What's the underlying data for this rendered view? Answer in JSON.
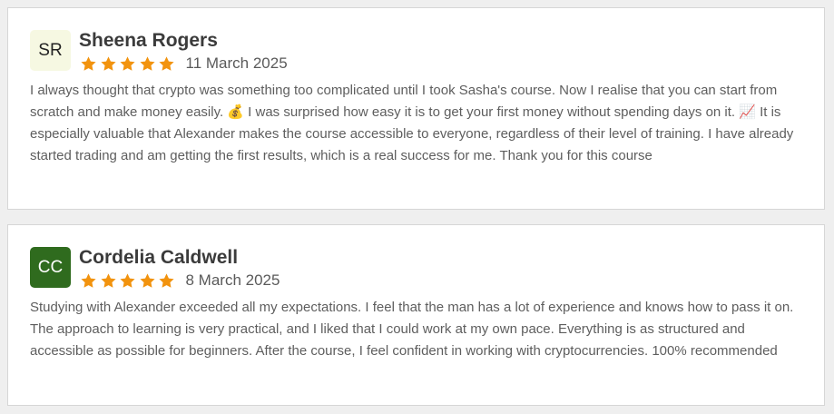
{
  "reviews": [
    {
      "initials": "SR",
      "avatar_bg": "#f6f8e2",
      "avatar_fg": "#222222",
      "name": "Sheena Rogers",
      "rating": 5,
      "date": "11 March 2025",
      "text": "I always thought that crypto was something too complicated until I took Sasha's course. Now I realise that you can start from scratch and make money easily. 💰 I was surprised how easy it is to get your first money without spending days on it. 📈 It is especially valuable that Alexander makes the course accessible to everyone, regardless of their level of training. I have already started trading and am getting the first results, which is a real success for me. Thank you for this course"
    },
    {
      "initials": "CC",
      "avatar_bg": "#2f6b1e",
      "avatar_fg": "#ffffff",
      "name": "Cordelia Caldwell",
      "rating": 5,
      "date": "8 March 2025",
      "text": "Studying with Alexander exceeded all my expectations. I feel that the man has a lot of experience and knows how to pass it on. The approach to learning is very practical, and I liked that I could work at my own pace. Everything is as structured and accessible as possible for beginners. After the course, I feel confident in working with cryptocurrencies. 100% recommended"
    }
  ],
  "colors": {
    "star": "#f2930e",
    "page_bg": "#efefef",
    "card_border": "#d6d6d6",
    "name": "#3b3b3b",
    "text": "#5e5e5e"
  },
  "icons": {
    "star": "star-icon"
  }
}
